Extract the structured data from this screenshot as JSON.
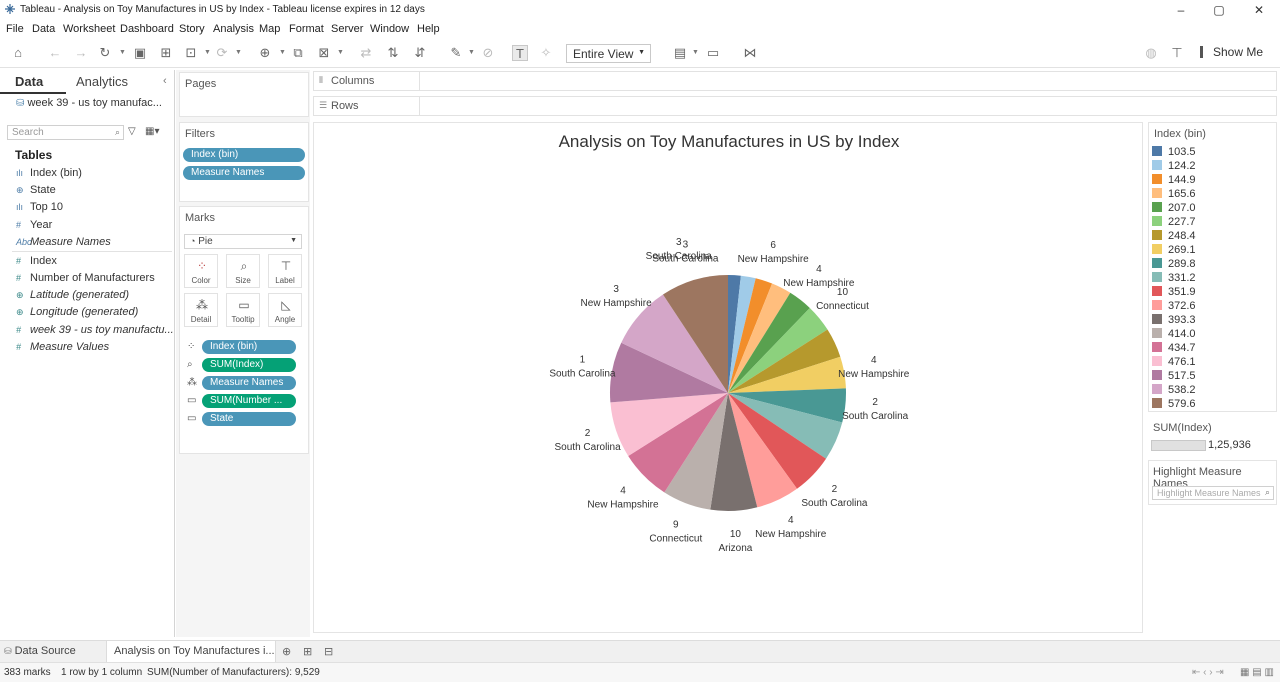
{
  "window": {
    "title": "Tableau - Analysis on Toy Manufactures in US by Index - Tableau license expires in 12 days"
  },
  "menu": [
    "File",
    "Data",
    "Worksheet",
    "Dashboard",
    "Story",
    "Analysis",
    "Map",
    "Format",
    "Server",
    "Window",
    "Help"
  ],
  "toolbar": {
    "view_mode": "Entire View",
    "show_me": "Show Me"
  },
  "data_pane": {
    "tab_data": "Data",
    "tab_analytics": "Analytics",
    "data_source": "week 39 - us toy manufac...",
    "search_placeholder": "Search",
    "tables_header": "Tables",
    "fields": [
      {
        "label": "Index (bin)",
        "icon": "ılı",
        "italic": false
      },
      {
        "label": "State",
        "icon": "⊕",
        "italic": false
      },
      {
        "label": "Top 10",
        "icon": "ılı",
        "italic": false
      },
      {
        "label": "Year",
        "icon": "#",
        "italic": false
      },
      {
        "label": "Measure Names",
        "icon": "Abc",
        "italic": true
      },
      {
        "label": "Index",
        "icon": "#",
        "italic": false
      },
      {
        "label": "Number of Manufacturers",
        "icon": "#",
        "italic": false
      },
      {
        "label": "Latitude (generated)",
        "icon": "⊕",
        "italic": true
      },
      {
        "label": "Longitude (generated)",
        "icon": "⊕",
        "italic": true
      },
      {
        "label": "week 39 - us toy manufactu...",
        "icon": "#",
        "italic": true
      },
      {
        "label": "Measure Values",
        "icon": "#",
        "italic": true
      }
    ]
  },
  "shelves": {
    "pages": "Pages",
    "filters": "Filters",
    "filter_pills": [
      "Index (bin)",
      "Measure Names"
    ],
    "marks": "Marks",
    "mark_type": "Pie",
    "mark_buttons": [
      "Color",
      "Size",
      "Label",
      "Detail",
      "Tooltip",
      "Angle"
    ],
    "mark_pills": [
      {
        "label": "Index (bin)",
        "color": "blue"
      },
      {
        "label": "SUM(Index)",
        "color": "green"
      },
      {
        "label": "Measure Names",
        "color": "blue"
      },
      {
        "label": "SUM(Number ...",
        "color": "green"
      },
      {
        "label": "State",
        "color": "blue"
      }
    ],
    "columns": "Columns",
    "rows": "Rows"
  },
  "chart_data": {
    "type": "pie",
    "title": "Analysis on Toy Manufactures in US by Index",
    "slices": [
      {
        "bin": "103.5",
        "color": "#4e79a7",
        "value": 1.2,
        "count": "",
        "state": ""
      },
      {
        "bin": "124.2",
        "color": "#a0cbe8",
        "value": 1.4,
        "count": "",
        "state": ""
      },
      {
        "bin": "144.9",
        "color": "#f28e2b",
        "value": 1.6,
        "count": "6",
        "state": "New Hampshire"
      },
      {
        "bin": "165.6",
        "color": "#ffbe7d",
        "value": 1.9,
        "count": "",
        "state": ""
      },
      {
        "bin": "207.0",
        "color": "#59a14f",
        "value": 2.3,
        "count": "4",
        "state": "New Hampshire"
      },
      {
        "bin": "227.7",
        "color": "#8cd17d",
        "value": 2.6,
        "count": "10",
        "state": "Connecticut"
      },
      {
        "bin": "248.4",
        "color": "#b6992d",
        "value": 2.8,
        "count": "",
        "state": ""
      },
      {
        "bin": "269.1",
        "color": "#f1ce63",
        "value": 3.0,
        "count": "4",
        "state": "New Hampshire"
      },
      {
        "bin": "289.8",
        "color": "#499894",
        "value": 3.2,
        "count": "2",
        "state": "South Carolina"
      },
      {
        "bin": "331.2",
        "color": "#86bcb6",
        "value": 3.7,
        "count": "",
        "state": ""
      },
      {
        "bin": "351.9",
        "color": "#e15759",
        "value": 3.9,
        "count": "2",
        "state": "South Carolina"
      },
      {
        "bin": "372.6",
        "color": "#ff9d9a",
        "value": 4.1,
        "count": "4",
        "state": "New Hampshire"
      },
      {
        "bin": "393.3",
        "color": "#79706e",
        "value": 4.4,
        "count": "10",
        "state": "Arizona"
      },
      {
        "bin": "414.0",
        "color": "#bab0ac",
        "value": 4.6,
        "count": "9",
        "state": "Connecticut"
      },
      {
        "bin": "434.7",
        "color": "#d37295",
        "value": 4.8,
        "count": "4",
        "state": "New Hampshire"
      },
      {
        "bin": "476.1",
        "color": "#fabfd2",
        "value": 5.3,
        "count": "2",
        "state": "South Carolina"
      },
      {
        "bin": "517.5",
        "color": "#b07aa1",
        "value": 5.7,
        "count": "1",
        "state": "South Carolina"
      },
      {
        "bin": "538.2",
        "color": "#d4a6c8",
        "value": 6.0,
        "count": "3",
        "state": "New Hampshire"
      },
      {
        "bin": "579.6",
        "color": "#9d7660",
        "value": 6.4,
        "count": "3",
        "state": "South Carolina"
      }
    ],
    "extra_labels": [
      {
        "count": "3",
        "state": "South Carolina"
      }
    ],
    "legend_title": "Index (bin)",
    "legend_position": "right"
  },
  "legend": {
    "size_title": "SUM(Index)",
    "size_value": "1,25,936",
    "highlight_title": "Highlight Measure Names",
    "highlight_placeholder": "Highlight Measure Names"
  },
  "tabs": {
    "data_source": "Data Source",
    "sheet": "Analysis on Toy Manufactures i..."
  },
  "status": {
    "marks": "383 marks",
    "dims": "1 row by 1 column",
    "sum": "SUM(Number of Manufacturers): 9,529"
  }
}
